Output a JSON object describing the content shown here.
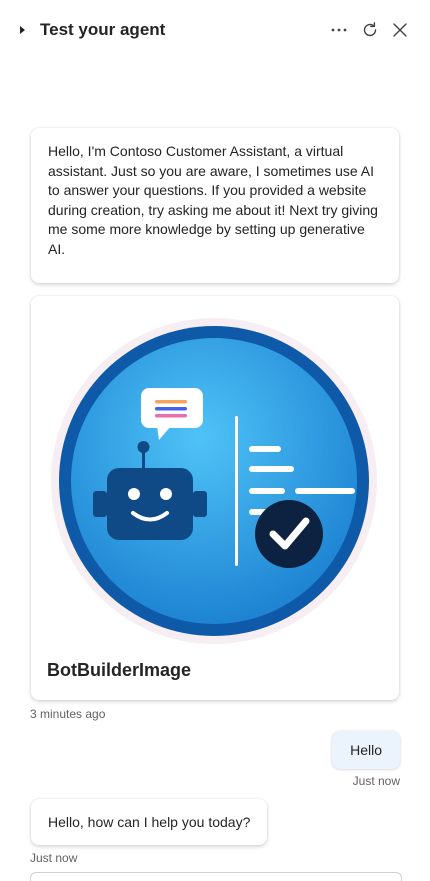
{
  "header": {
    "title": "Test your agent",
    "icons": [
      "caret-right-icon",
      "more-icon",
      "refresh-icon",
      "close-icon"
    ]
  },
  "messages": {
    "welcome": "Hello, I'm Contoso Customer Assistant, a virtual assistant. Just so you are aware, I sometimes use AI to answer your questions. If you provided a website during creation, try asking me about it! Next try giving me some more knowledge by setting up generative AI.",
    "card_title": "BotBuilderImage",
    "card_timestamp": "3 minutes ago",
    "user_message": "Hello",
    "user_timestamp": "Just now",
    "bot_reply": "Hello, how can I help you today?",
    "bot_reply_timestamp": "Just now"
  },
  "colors": {
    "user_bubble_bg": "#ebf3fc",
    "card_ring": "#0f5aa8",
    "card_inner": "#2fa6e8",
    "robot": "#104a86"
  }
}
